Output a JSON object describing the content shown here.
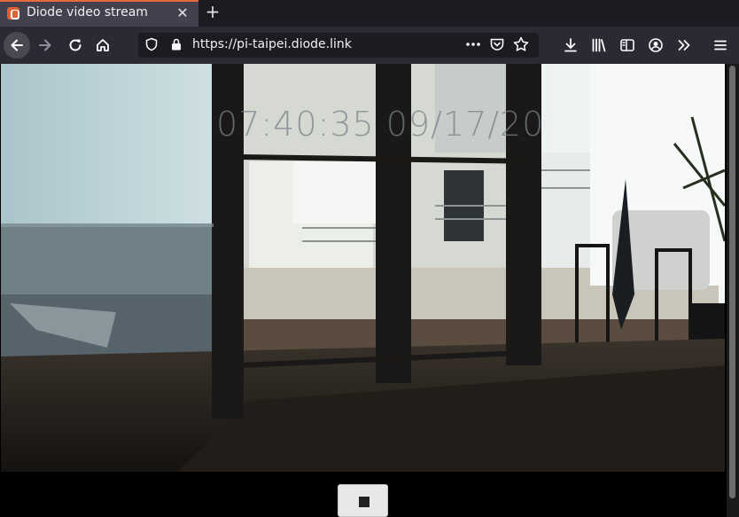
{
  "window": {
    "tab_title": "Diode video stream",
    "tab_close": "✕",
    "new_tab": "+"
  },
  "nav": {
    "url": "https://pi-taipei.diode.link"
  },
  "video": {
    "timestamp": "07:40:35 09/17/20"
  },
  "icons": {
    "back": "back-arrow-icon",
    "forward": "forward-arrow-icon",
    "reload": "reload-icon",
    "home": "home-icon",
    "shield": "tracking-shield-icon",
    "lock": "lock-icon",
    "page_actions": "more-dots-icon",
    "pocket": "pocket-icon",
    "bookmark": "star-icon",
    "downloads": "download-icon",
    "library": "library-icon",
    "sidebar": "sidebar-icon",
    "account": "account-icon",
    "overflow": "chevron-double-right-icon",
    "menu": "hamburger-menu-icon",
    "stop": "stop-icon"
  },
  "colors": {
    "tab_accent": "#e66a3b",
    "toolbar_bg": "#2b2a33",
    "url_bg": "#1c1b22"
  }
}
